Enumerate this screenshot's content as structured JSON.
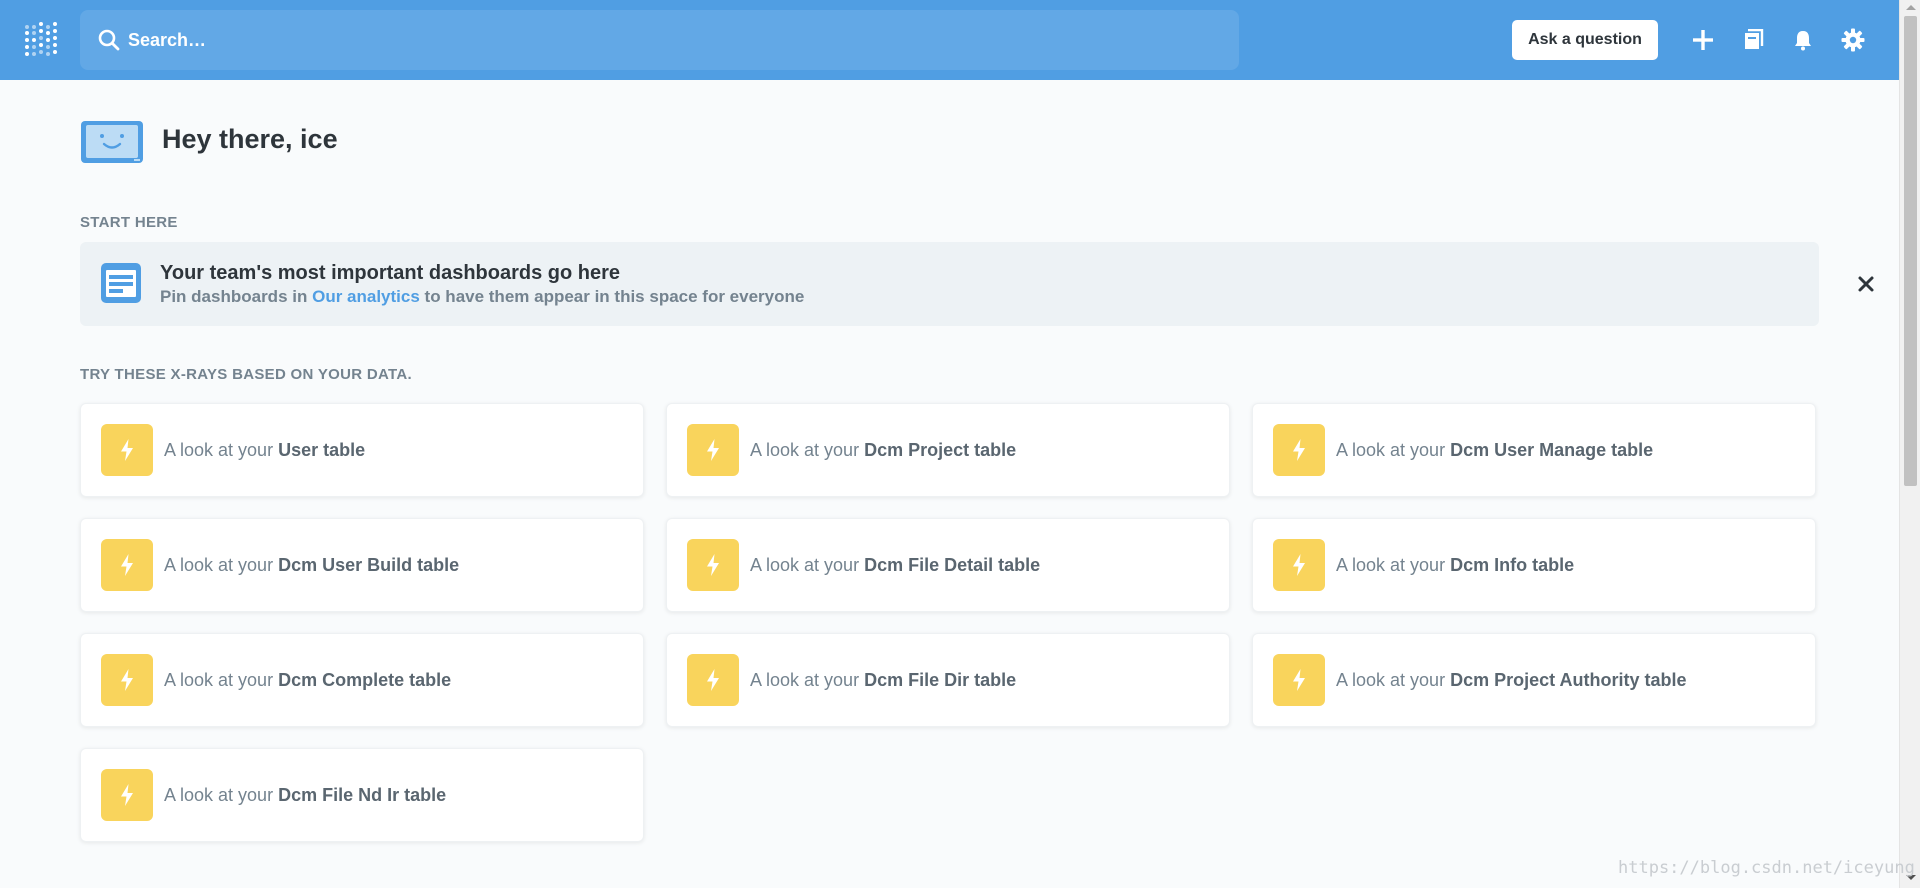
{
  "header": {
    "search_placeholder": "Search…",
    "ask_button": "Ask a question",
    "icons": [
      "plus-icon",
      "notebook-icon",
      "bell-icon",
      "gear-icon"
    ]
  },
  "greeting": {
    "text": "Hey there, ice"
  },
  "start_here": {
    "label": "START HERE",
    "title": "Your team's most important dashboards go here",
    "subtitle_before": "Pin dashboards in ",
    "subtitle_link": "Our analytics",
    "subtitle_after": " to have them appear in this space for everyone"
  },
  "xrays": {
    "label": "TRY THESE X-RAYS BASED ON YOUR DATA.",
    "prefix": "A look at your",
    "cards": [
      {
        "table": "User table"
      },
      {
        "table": "Dcm Project table"
      },
      {
        "table": "Dcm User Manage table"
      },
      {
        "table": "Dcm User Build table"
      },
      {
        "table": "Dcm File Detail table"
      },
      {
        "table": "Dcm Info table"
      },
      {
        "table": "Dcm Complete table"
      },
      {
        "table": "Dcm File Dir table"
      },
      {
        "table": "Dcm Project Authority table"
      },
      {
        "table": "Dcm File Nd Ir table"
      }
    ]
  },
  "watermark": "https://blog.csdn.net/iceyung",
  "colors": {
    "brand": "#509ee3",
    "xray_icon_bg": "#f9d45c",
    "page_bg": "#f9fbfc"
  }
}
